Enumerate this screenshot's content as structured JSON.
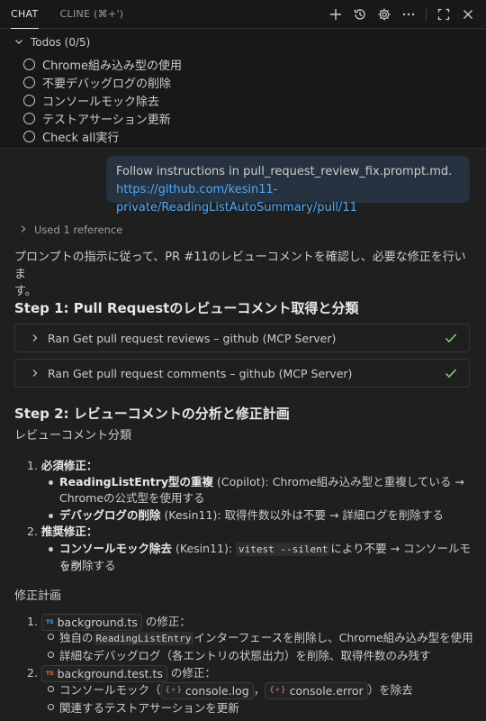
{
  "tabs": [
    {
      "label": "CHAT",
      "active": true
    },
    {
      "label": "CLINE (⌘+')",
      "active": false
    }
  ],
  "top_icons": [
    "plus-icon",
    "history-icon",
    "gear-icon",
    "more-icon",
    "maximize-icon",
    "close-icon"
  ],
  "todos": {
    "header": "Todos (0/5)",
    "items": [
      "Chrome組み込み型の使用",
      "不要デバッグログの削除",
      "コンソールモック除去",
      "テストアサーション更新",
      "Check all実行"
    ]
  },
  "user_message": {
    "line1": "Follow instructions in pull_request_review_fix.prompt.md.",
    "link": "https://github.com/kesin11-private/ReadingListAutoSummary/pull/11"
  },
  "reference": "Used 1 reference",
  "intro_line1": "プロンプトの指示に従って、PR #11のレビューコメントを確認し、必要な修正を行いま",
  "intro_line2": "す。",
  "step1": {
    "title": "Step 1: Pull Requestのレビューコメント取得と分類",
    "tools": [
      "Ran Get pull request reviews – github (MCP Server)",
      "Ran Get pull request comments – github (MCP Server)"
    ]
  },
  "step2": {
    "title": "Step 2: レビューコメントの分析と修正計画",
    "classification_label": "レビューコメント分類",
    "required_label": "必須修正：",
    "req1_bold": "ReadingListEntry型の重複",
    "req1_rest": " (Copilot): Chrome組み込み型と重複している →",
    "req1_line2": "Chromeの公式型を使用する",
    "req2_bold": "デバッグログの削除",
    "req2_rest": " (Kesin11): 取得件数以外は不要 → 詳細ログを削除する",
    "recommended_label": "推奨修正：",
    "rec1_bold": "コンソールモック除去",
    "rec1_mid": " (Kesin11): ",
    "rec1_code": "vitest --silent",
    "rec1_rest": "により不要 → コンソールモック",
    "rec1_line2": "を削除する",
    "plan_label": "修正計画",
    "plan1_file": "background.ts",
    "plan1_suffix": " の修正：",
    "plan1_a_pre": "独自の",
    "plan1_a_code": "ReadingListEntry",
    "plan1_a_post": "インターフェースを削除し、Chrome組み込み型を使用",
    "plan1_b": "詳細なデバッグログ（各エントリの状態出力）を削除、取得件数のみ残す",
    "plan2_file": "background.test.ts",
    "plan2_suffix": " の修正：",
    "plan2_a_pre": "コンソールモック（",
    "plan2_a_chip1": "console.log",
    "plan2_a_comma": "，",
    "plan2_a_chip2": "console.error",
    "plan2_a_post": "）を除去",
    "plan2_b": "関連するテストアサーションを更新",
    "ts_badge": "TS",
    "brace_badge": "{⚬}"
  }
}
